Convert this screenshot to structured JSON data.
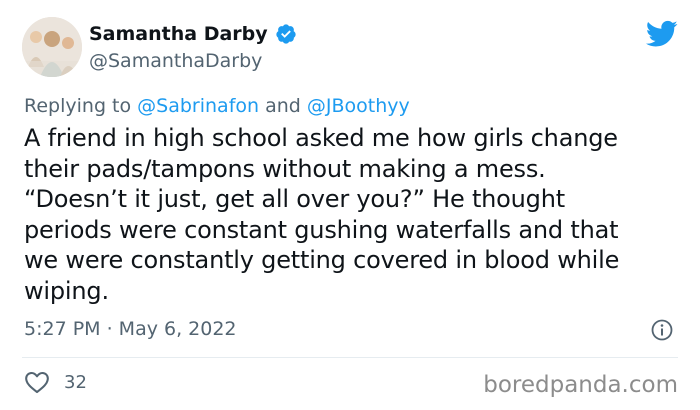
{
  "author": {
    "display_name": "Samantha Darby",
    "handle": "@SamanthaDarby",
    "verified_icon": "verified-badge-icon",
    "avatar_icon": "profile-photo"
  },
  "brand": {
    "logo_icon": "twitter-bird-icon",
    "color": "#1d9bf0"
  },
  "reply": {
    "prefix": "Replying to ",
    "mention_1": "@Sabrinafon",
    "joiner": " and ",
    "mention_2": "@JBoothyy"
  },
  "tweet": {
    "text": "A friend in high school asked me how girls change\ntheir pads/tampons without making a mess.\n“Doesn’t it just, get all over you?” He thought\nperiods were constant gushing waterfalls and that\nwe were constantly getting covered in blood while\nwiping.",
    "timestamp": "5:27 PM · May 6, 2022",
    "info_icon": "info-icon"
  },
  "actions": {
    "like_icon": "heart-icon",
    "like_count": "32"
  },
  "watermark": "boredpanda.com",
  "colors": {
    "text": "#0f1419",
    "secondary_text": "#536471",
    "link": "#1d9bf0",
    "divider": "#e6ecf0"
  }
}
